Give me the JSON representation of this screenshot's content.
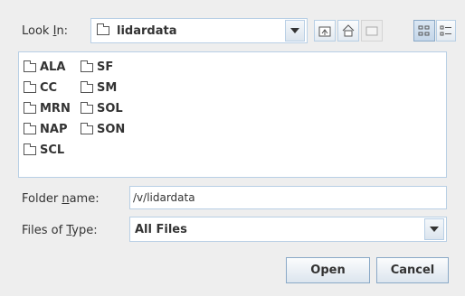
{
  "look_in": {
    "label_pre": "Look ",
    "label_mnemonic": "I",
    "label_post": "n:",
    "selected": "lidardata"
  },
  "toolbar": {
    "up_icon": "up-folder-icon",
    "home_icon": "home-icon",
    "new_folder_icon": "new-folder-icon",
    "list_view_icon": "list-view-icon",
    "details_view_icon": "details-view-icon"
  },
  "files": {
    "col1": [
      "ALA",
      "CC",
      "MRN",
      "NAP",
      "SCL"
    ],
    "col2": [
      "SF",
      "SM",
      "SOL",
      "SON"
    ]
  },
  "folder_name": {
    "label_pre": "Folder ",
    "label_mnemonic": "n",
    "label_post": "ame:",
    "value": "/v/lidardata"
  },
  "files_of_type": {
    "label_pre": "Files of ",
    "label_mnemonic": "T",
    "label_post": "ype:",
    "value": "All Files"
  },
  "buttons": {
    "open": "Open",
    "cancel": "Cancel"
  },
  "colors": {
    "background": "#eeeeee",
    "border": "#b8cfe5"
  }
}
